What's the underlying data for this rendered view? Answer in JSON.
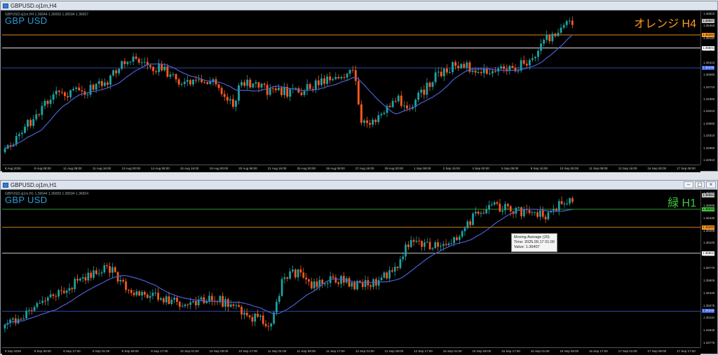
{
  "windows": [
    {
      "title": "GBPUSD.oj1m,H4",
      "ohlc": "GBPUSD.oj1m,H4  1.36644 1.36659 1.36594 1.36657",
      "symbol_label": "GBP USD",
      "timeframe_label": "オレンジ H4",
      "timeframe_color": "#ff9a1f",
      "price_ticks": [
        "1.36810",
        "1.36460",
        "1.36110",
        "1.35760",
        "1.35410",
        "1.35060",
        "1.34710",
        "1.34360",
        "1.34010",
        "1.33660",
        "1.33310",
        "1.32960",
        "1.32610"
      ],
      "price_tags": [
        {
          "label": "1.36657",
          "color": "#c0c0c0",
          "text_color": "#000"
        },
        {
          "label": "1.36283",
          "color": "#ff9a1f",
          "text_color": "#000"
        },
        {
          "label": "1.35901",
          "color": "#ffffff",
          "text_color": "#000"
        },
        {
          "label": "1.35346",
          "color": "#3a5fd8",
          "text_color": "#fff"
        }
      ],
      "time_labels": [
        "8 Aug 2025",
        "8 Aug 08:00",
        "11 Aug 08:00",
        "11 Aug 16:00",
        "13 Aug 00:00",
        "14 Aug 08:00",
        "15 Aug 16:00",
        "19 Aug 00:00",
        "20 Aug 08:00",
        "21 Aug 16:00",
        "25 Aug 00:00",
        "26 Aug 08:00",
        "27 Aug 16:00",
        "29 Aug 00:00",
        "1 Sep 08:00",
        "2 Sep 16:00",
        "4 Sep 00:00",
        "5 Sep 08:00",
        "8 Sep 16:00",
        "10 Sep 00:00",
        "11 Sep 08:00",
        "12 Sep 16:00",
        "16 Sep 00:00",
        "17 Sep 08:00"
      ]
    },
    {
      "title": "GBPUSD.oj1m,H1",
      "ohlc": "GBPUSD.oj1m,H1  1.36644 1.36659 1.36594 1.36654",
      "symbol_label": "GBP USD",
      "timeframe_label": "緑 H1",
      "timeframe_color": "#3ec43e",
      "price_ticks": [
        "1.36760",
        "1.36595",
        "1.36430",
        "1.36265",
        "1.36100",
        "1.35935",
        "1.35770",
        "1.35605",
        "1.35440",
        "1.35275",
        "1.35110",
        "1.34945",
        "1.34775"
      ],
      "price_tags": [
        {
          "label": "1.36654",
          "color": "#c0c0c0",
          "text_color": "#000"
        },
        {
          "label": "1.36534",
          "color": "#3ec43e",
          "text_color": "#000"
        },
        {
          "label": "1.36283",
          "color": "#ff9a1f",
          "text_color": "#000"
        },
        {
          "label": "1.35901",
          "color": "#ffffff",
          "text_color": "#000"
        },
        {
          "label": "1.35346",
          "color": "#3a5fd8",
          "text_color": "#fff"
        }
      ],
      "time_labels": [
        "8 Sep 2025",
        "8 Sep 09:00",
        "8 Sep 17:00",
        "9 Sep 01:00",
        "9 Sep 09:00",
        "9 Sep 17:00",
        "10 Sep 01:00",
        "10 Sep 09:00",
        "10 Sep 17:00",
        "11 Sep 01:00",
        "11 Sep 09:00",
        "11 Sep 17:00",
        "12 Sep 01:00",
        "12 Sep 09:00",
        "12 Sep 17:00",
        "15 Sep 01:00",
        "15 Sep 09:00",
        "15 Sep 17:00",
        "16 Sep 01:00",
        "16 Sep 09:00",
        "16 Sep 17:00",
        "17 Sep 01:00",
        "17 Sep 09:00",
        "17 Sep 17:00"
      ],
      "tooltip": {
        "line1": "Moving Average (20)",
        "line2": "Time: 2025.09.17 01:00",
        "line3": "Value: 1.36407"
      }
    }
  ],
  "colors": {
    "bull": "#1fa3a3",
    "bear": "#ff5a1f",
    "ma": "#4a5fd0"
  }
}
